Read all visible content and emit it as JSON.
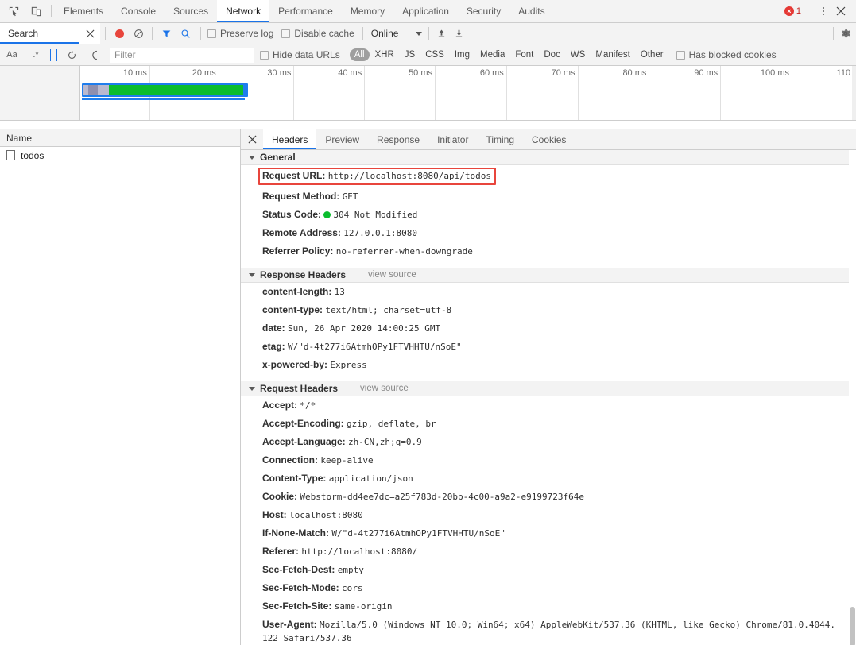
{
  "devtools": {
    "icons": {
      "inspect": "inspect-element-icon",
      "device": "device-toolbar-icon"
    },
    "tabs": [
      {
        "label": "Elements",
        "active": false
      },
      {
        "label": "Console",
        "active": false
      },
      {
        "label": "Sources",
        "active": false
      },
      {
        "label": "Network",
        "active": true
      },
      {
        "label": "Performance",
        "active": false
      },
      {
        "label": "Memory",
        "active": false
      },
      {
        "label": "Application",
        "active": false
      },
      {
        "label": "Security",
        "active": false
      },
      {
        "label": "Audits",
        "active": false
      }
    ],
    "error_count": "1",
    "accent_color": "#1a73e8",
    "error_color": "#e53935"
  },
  "network_toolbar": {
    "search_tab_label": "Search",
    "record_title": "record-button",
    "clear_title": "clear-button",
    "filter_title": "filter-button",
    "search_title": "search-button",
    "preserve_log_label": "Preserve log",
    "preserve_log_checked": false,
    "disable_cache_label": "Disable cache",
    "disable_cache_checked": false,
    "throttle_value": "Online",
    "import_title": "import-har-button",
    "export_title": "export-har-button",
    "settings_title": "settings-gear-button"
  },
  "filter_bar": {
    "match_case_label": "Aa",
    "regex_label": ".*",
    "refresh_title": "refresh-button",
    "filter_placeholder": "Filter",
    "filter_value": "",
    "hide_data_urls_label": "Hide data URLs",
    "hide_data_urls_checked": false,
    "types": [
      {
        "label": "All",
        "selected": true
      },
      {
        "label": "XHR",
        "selected": false
      },
      {
        "label": "JS",
        "selected": false
      },
      {
        "label": "CSS",
        "selected": false
      },
      {
        "label": "Img",
        "selected": false
      },
      {
        "label": "Media",
        "selected": false
      },
      {
        "label": "Font",
        "selected": false
      },
      {
        "label": "Doc",
        "selected": false
      },
      {
        "label": "WS",
        "selected": false
      },
      {
        "label": "Manifest",
        "selected": false
      },
      {
        "label": "Other",
        "selected": false
      }
    ],
    "has_blocked_cookies_label": "Has blocked cookies",
    "has_blocked_cookies_checked": false
  },
  "overview": {
    "ticks": [
      "10 ms",
      "20 ms",
      "30 ms",
      "40 ms",
      "50 ms",
      "60 ms",
      "70 ms",
      "80 ms",
      "90 ms",
      "100 ms",
      "110"
    ],
    "bar_colors": {
      "network": "#1f7ded",
      "download": "#0bbd2e",
      "waiting": "#b9b9cf"
    }
  },
  "request_list": {
    "column_header": "Name",
    "rows": [
      {
        "name": "todos",
        "selected": false,
        "icon": "document-icon"
      }
    ]
  },
  "details": {
    "tabs": [
      {
        "label": "Headers",
        "active": true
      },
      {
        "label": "Preview",
        "active": false
      },
      {
        "label": "Response",
        "active": false
      },
      {
        "label": "Initiator",
        "active": false
      },
      {
        "label": "Timing",
        "active": false
      },
      {
        "label": "Cookies",
        "active": false
      }
    ],
    "sections": [
      {
        "title": "General",
        "view_source": "",
        "rows": [
          {
            "name": "Request URL:",
            "value": "http://localhost:8080/api/todos",
            "highlighted": true
          },
          {
            "name": "Request Method:",
            "value": "GET"
          },
          {
            "name": "Status Code:",
            "value": "304 Not Modified",
            "status_dot": true
          },
          {
            "name": "Remote Address:",
            "value": "127.0.0.1:8080"
          },
          {
            "name": "Referrer Policy:",
            "value": "no-referrer-when-downgrade"
          }
        ]
      },
      {
        "title": "Response Headers",
        "view_source": "view source",
        "rows": [
          {
            "name": "content-length:",
            "value": "13"
          },
          {
            "name": "content-type:",
            "value": "text/html; charset=utf-8"
          },
          {
            "name": "date:",
            "value": "Sun, 26 Apr 2020 14:00:25 GMT"
          },
          {
            "name": "etag:",
            "value": "W/\"d-4t277i6AtmhOPy1FTVHHTU/nSoE\""
          },
          {
            "name": "x-powered-by:",
            "value": "Express"
          }
        ]
      },
      {
        "title": "Request Headers",
        "view_source": "view source",
        "rows": [
          {
            "name": "Accept:",
            "value": "*/*"
          },
          {
            "name": "Accept-Encoding:",
            "value": "gzip, deflate, br"
          },
          {
            "name": "Accept-Language:",
            "value": "zh-CN,zh;q=0.9"
          },
          {
            "name": "Connection:",
            "value": "keep-alive"
          },
          {
            "name": "Content-Type:",
            "value": "application/json"
          },
          {
            "name": "Cookie:",
            "value": "Webstorm-dd4ee7dc=a25f783d-20bb-4c00-a9a2-e9199723f64e"
          },
          {
            "name": "Host:",
            "value": "localhost:8080"
          },
          {
            "name": "If-None-Match:",
            "value": "W/\"d-4t277i6AtmhOPy1FTVHHTU/nSoE\""
          },
          {
            "name": "Referer:",
            "value": "http://localhost:8080/"
          },
          {
            "name": "Sec-Fetch-Dest:",
            "value": "empty"
          },
          {
            "name": "Sec-Fetch-Mode:",
            "value": "cors"
          },
          {
            "name": "Sec-Fetch-Site:",
            "value": "same-origin"
          },
          {
            "name": "User-Agent:",
            "value": "Mozilla/5.0 (Windows NT 10.0; Win64; x64) AppleWebKit/537.36 (KHTML, like Gecko) Chrome/81.0.4044.122 Safari/537.36"
          }
        ]
      }
    ]
  }
}
